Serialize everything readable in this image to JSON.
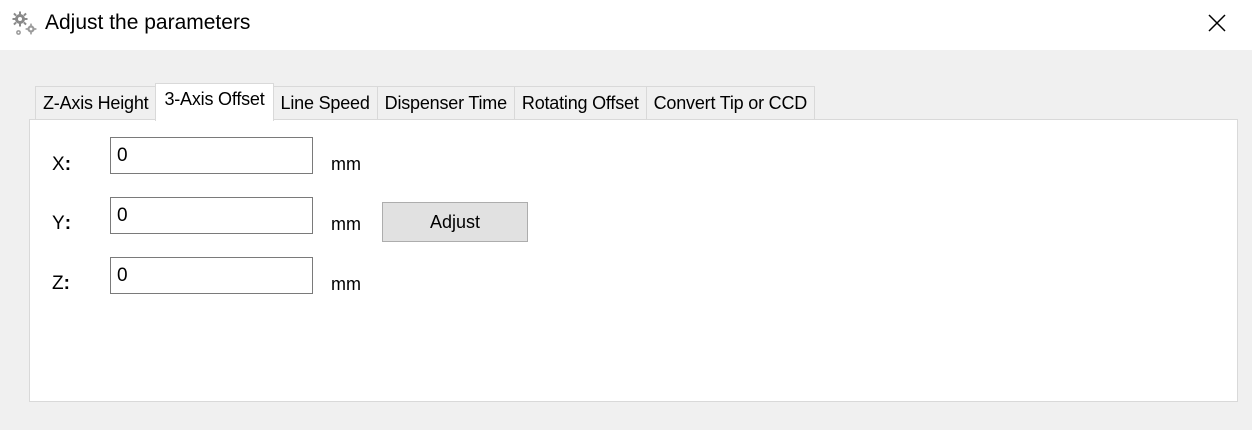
{
  "window": {
    "title": "Adjust the parameters",
    "title_icon": "gears-icon",
    "close_icon": "close-icon"
  },
  "tabs": [
    {
      "label": "Z-Axis Height",
      "active": false
    },
    {
      "label": "3-Axis Offset",
      "active": true
    },
    {
      "label": "Line Speed",
      "active": false
    },
    {
      "label": "Dispenser Time",
      "active": false
    },
    {
      "label": "Rotating Offset",
      "active": false
    },
    {
      "label": "Convert Tip or CCD",
      "active": false
    }
  ],
  "offset": {
    "x": {
      "label": "X",
      "value": "0",
      "unit": "mm"
    },
    "y": {
      "label": "Y",
      "value": "0",
      "unit": "mm"
    },
    "z": {
      "label": "Z",
      "value": "0",
      "unit": "mm"
    },
    "adjust_label": "Adjust"
  }
}
